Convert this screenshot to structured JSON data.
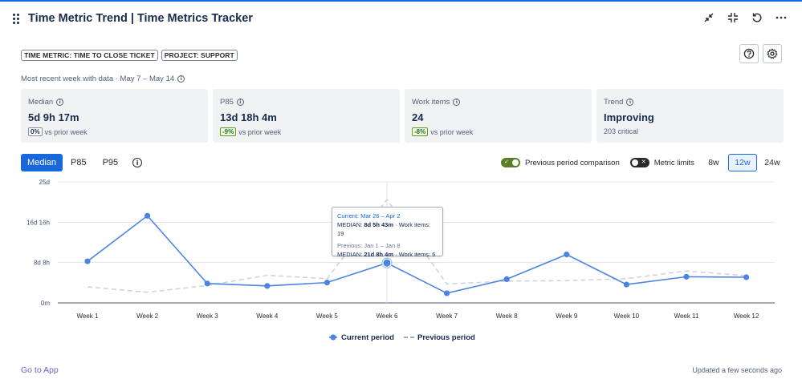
{
  "header": {
    "title": "Time Metric Trend | Time Metrics Tracker"
  },
  "tags": [
    "TIME METRIC: TIME TO CLOSE TICKET",
    "PROJECT: SUPPORT"
  ],
  "subtitle": "Most recent week with data · May 7 – May 14",
  "cards": [
    {
      "label": "Median",
      "value": "5d 9h 17m",
      "chip": "0%",
      "chip_style": "neutral",
      "sub": "vs prior week"
    },
    {
      "label": "P85",
      "value": "13d 18h 4m",
      "chip": "-9%",
      "chip_style": "green",
      "sub": "vs prior week"
    },
    {
      "label": "Work items",
      "value": "24",
      "chip": "-8%",
      "chip_style": "green",
      "sub": "vs prior week"
    },
    {
      "label": "Trend",
      "value": "Improving",
      "chip": "",
      "chip_style": "",
      "sub": "203 critical"
    }
  ],
  "metric_tabs": [
    "Median",
    "P85",
    "P95"
  ],
  "controls": {
    "previous_period_label": "Previous period comparison",
    "metric_limits_label": "Metric limits",
    "ranges": [
      "8w",
      "12w",
      "24w"
    ],
    "selected_range": "12w"
  },
  "tooltip": {
    "current_title": "Current: Mar 26 – Apr 2",
    "current_prefix": "MEDIAN: ",
    "current_value": "8d 5h 43m",
    "current_suffix": " · Work items: 19",
    "previous_title": "Previous: Jan 1 – Jan 8",
    "previous_prefix": "MEDIAN: ",
    "previous_value": "21d 8h 4m",
    "previous_suffix": " · Work items: 6"
  },
  "chart_data": {
    "type": "line",
    "x": [
      "Week 1",
      "Week 2",
      "Week 3",
      "Week 4",
      "Week 5",
      "Week 6",
      "Week 7",
      "Week 8",
      "Week 9",
      "Week 10",
      "Week 11",
      "Week 12"
    ],
    "y_ticks": [
      "0m",
      "8d 8h",
      "16d 16h",
      "25d"
    ],
    "y_tick_values": [
      0,
      8.33,
      16.67,
      25
    ],
    "ylim": [
      0,
      25
    ],
    "y_unit": "days",
    "series": [
      {
        "name": "Current period",
        "values": [
          8.6,
          18.0,
          4.0,
          3.5,
          4.2,
          8.24,
          2.0,
          4.9,
          10.0,
          3.8,
          5.4,
          5.3
        ],
        "color": "#4a84e0",
        "style": "solid"
      },
      {
        "name": "Previous period",
        "values": [
          3.3,
          2.2,
          3.6,
          5.7,
          5.0,
          21.34,
          3.9,
          4.5,
          4.6,
          5.0,
          6.6,
          5.6
        ],
        "color": "#d0d4da",
        "style": "dashed"
      }
    ],
    "highlight_index": 5,
    "grid": true,
    "legend": "bottom"
  },
  "footer": {
    "link": "Go to App",
    "updated": "Updated a few seconds ago"
  }
}
